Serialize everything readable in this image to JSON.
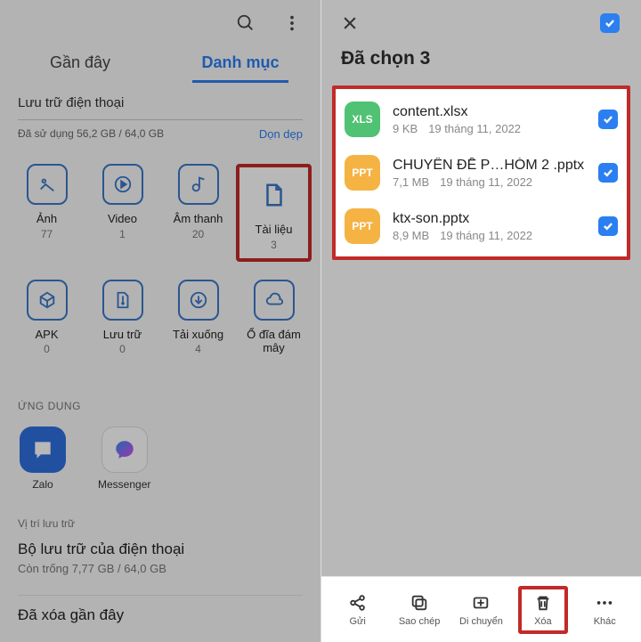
{
  "left": {
    "tabs": {
      "recent": "Gần đây",
      "categories": "Danh mục"
    },
    "storage": {
      "title": "Lưu trữ điện thoại",
      "used": "Đã sử dụng 56,2 GB / 64,0 GB",
      "clean": "Dọn dẹp"
    },
    "cats": [
      {
        "nm": "Ảnh",
        "ct": "77"
      },
      {
        "nm": "Video",
        "ct": "1"
      },
      {
        "nm": "Âm thanh",
        "ct": "20"
      },
      {
        "nm": "Tài liệu",
        "ct": "3"
      },
      {
        "nm": "APK",
        "ct": "0"
      },
      {
        "nm": "Lưu trữ",
        "ct": "0"
      },
      {
        "nm": "Tải xuống",
        "ct": "4"
      },
      {
        "nm": "Ổ đĩa đám mây",
        "ct": ""
      }
    ],
    "apps_title": "ỨNG DỤNG",
    "apps": [
      {
        "nm": "Zalo"
      },
      {
        "nm": "Messenger"
      }
    ],
    "loc_title": "Vị trí lưu trữ",
    "loc": {
      "nm": "Bộ lưu trữ của điện thoại",
      "sub": "Còn trống 7,77 GB / 64,0 GB"
    },
    "deleted": "Đã xóa gần đây"
  },
  "right": {
    "title": "Đã chọn 3",
    "files": [
      {
        "type": "XLS",
        "nm": "content.xlsx",
        "sz": "9 KB",
        "dt": "19 tháng 11, 2022"
      },
      {
        "type": "PPT",
        "nm": "CHUYÊN ĐỀ P…HÓM 2 .pptx",
        "sz": "7,1 MB",
        "dt": "19 tháng 11, 2022"
      },
      {
        "type": "PPT",
        "nm": "ktx-son.pptx",
        "sz": "8,9 MB",
        "dt": "19 tháng 11, 2022"
      }
    ],
    "bar": {
      "send": "Gửi",
      "copy": "Sao chép",
      "move": "Di chuyển",
      "delete": "Xóa",
      "more": "Khác"
    }
  }
}
